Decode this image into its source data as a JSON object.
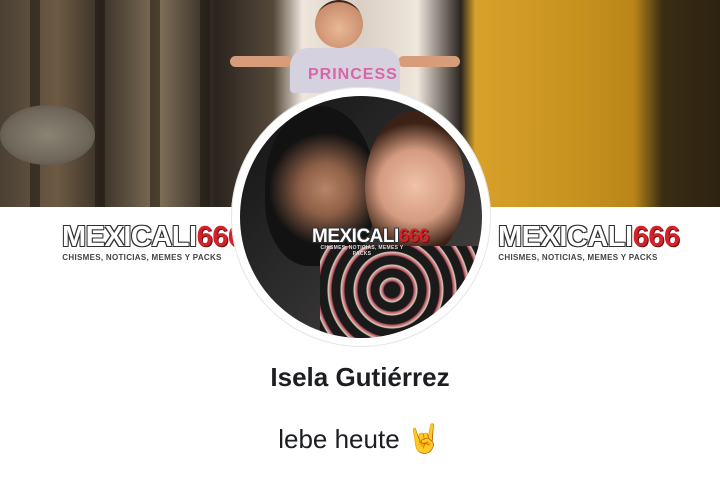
{
  "profile": {
    "cover_shirt_text": "PRINCESS",
    "watermark": {
      "word": "MEXICALI",
      "number": "666",
      "tagline": "CHISMES, NOTICIAS, MEMES Y PACKS"
    },
    "name": "Isela Gutiérrez",
    "bio": "lebe heute",
    "bio_emoji": "🤘"
  },
  "icons": {
    "bio_emoji": "rock-hand-icon"
  }
}
